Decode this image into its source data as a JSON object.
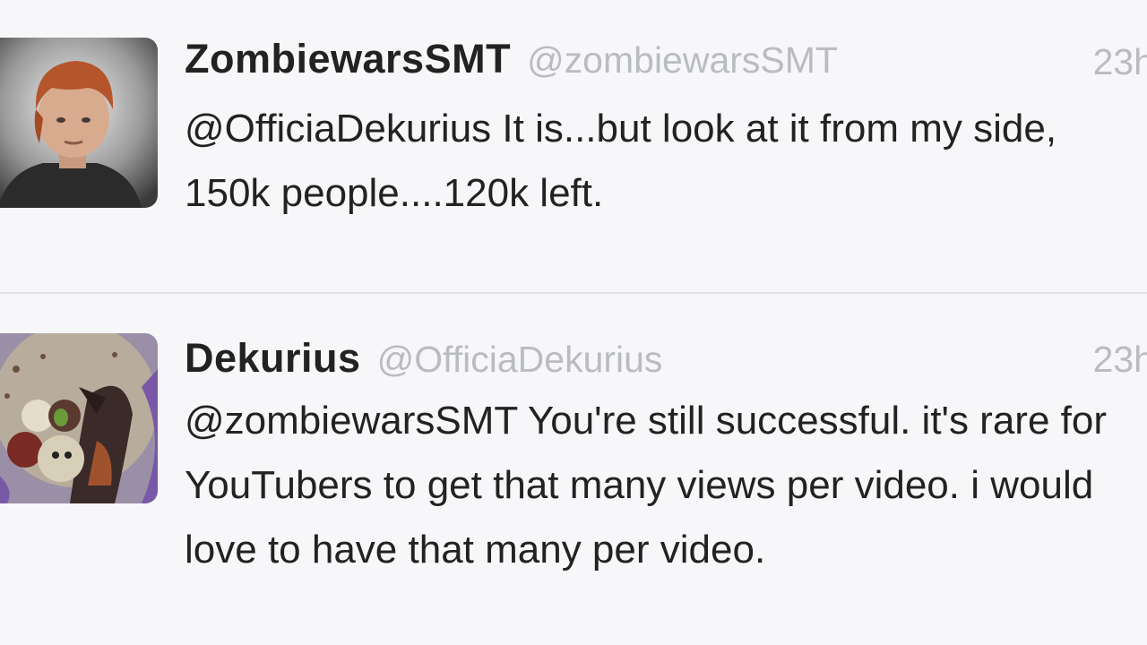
{
  "tweets": [
    {
      "display_name": "ZombiewarsSMT",
      "handle": "@zombiewarsSMT",
      "time": "23h",
      "text": "@OfficiaDekurius It is...but look at it from my side, 150k people....120k left.",
      "avatar": "avatar-cartoon-boy-icon"
    },
    {
      "display_name": "Dekurius",
      "handle": "@OfficiaDekurius",
      "time": "23h",
      "text": "@zombiewarsSMT You're still successful. it's rare for YouTubers to get that many views per video. i would love to have that many per video.",
      "avatar": "avatar-cartoon-group-icon"
    }
  ],
  "colors": {
    "background": "#f7f7f9",
    "name": "#222222",
    "handle": "#b9bcc2",
    "divider": "#e2e3e7"
  }
}
